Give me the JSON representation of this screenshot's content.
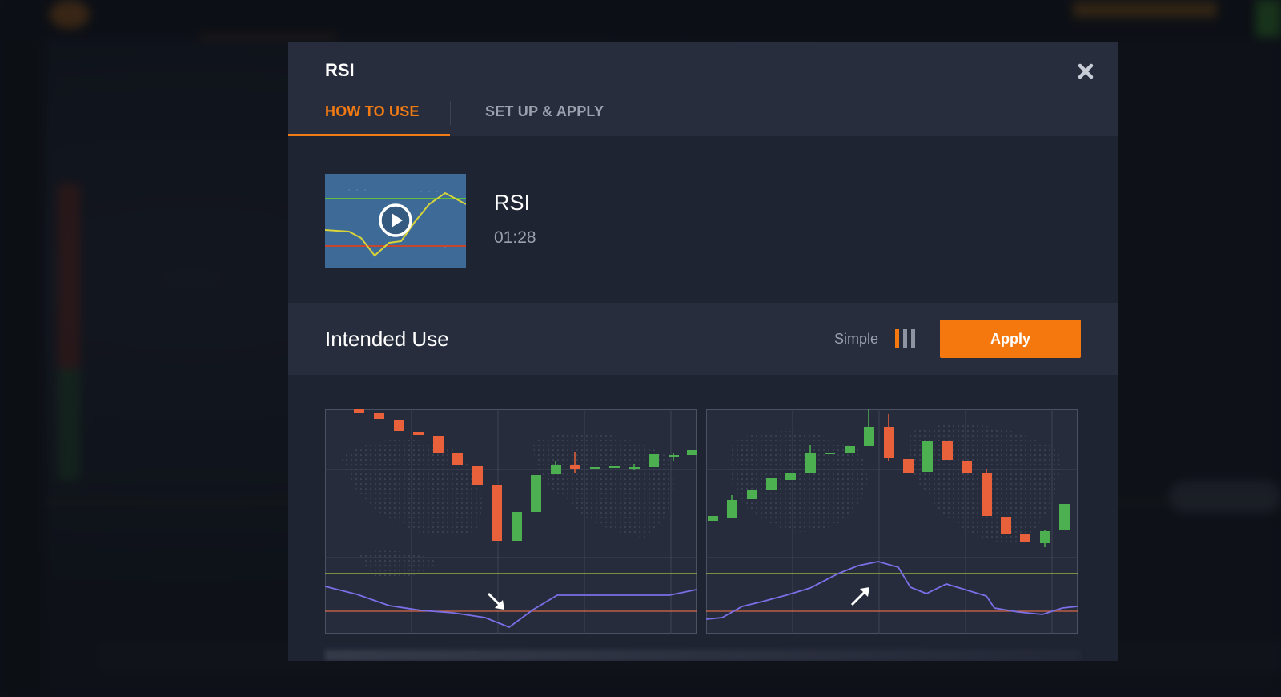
{
  "modal": {
    "title": "RSI",
    "tabs": [
      {
        "label": "HOW TO USE",
        "active": true
      },
      {
        "label": "SET UP & APPLY",
        "active": false
      }
    ],
    "video": {
      "title": "RSI",
      "duration": "01:28"
    },
    "intended_use": {
      "title": "Intended Use",
      "complexity_label": "Simple",
      "apply_label": "Apply"
    }
  },
  "colors": {
    "accent": "#f5780e",
    "bullish": "#4caf50",
    "bearish": "#e8613a",
    "rsi_line": "#7b6fe8",
    "overbought_line": "#a4c94a",
    "oversold_line": "#d86a4a"
  },
  "icons": {
    "close": "close-icon",
    "play": "play-icon",
    "complexity": "complexity-bars-icon",
    "arrow_down": "arrow-down-right-icon",
    "arrow_up": "arrow-up-right-icon"
  }
}
